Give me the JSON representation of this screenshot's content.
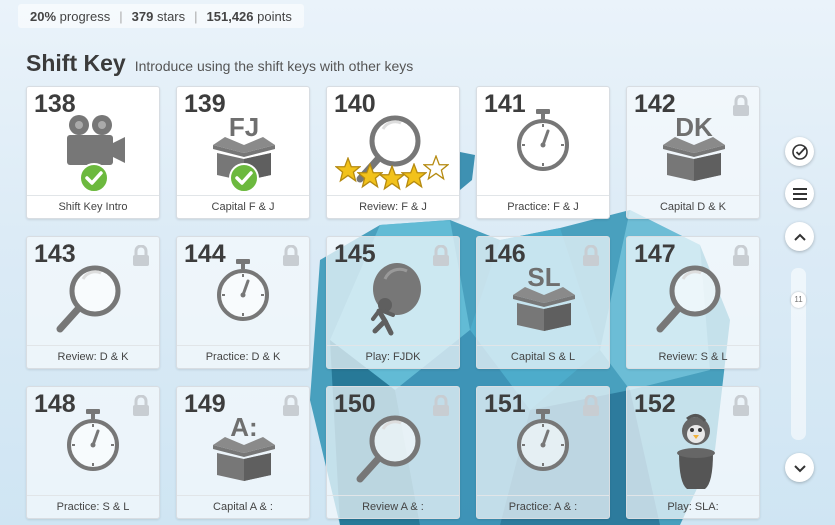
{
  "stats": {
    "progress_value": "20%",
    "progress_label": "progress",
    "stars_value": "379",
    "stars_label": "stars",
    "points_value": "151,426",
    "points_label": "points"
  },
  "section": {
    "title": "Shift Key",
    "subtitle": "Introduce using the shift keys with other keys"
  },
  "lessons": [
    {
      "num": "138",
      "label": "Shift Key Intro",
      "icon": "video-camera-icon",
      "locked": false,
      "status": "completed"
    },
    {
      "num": "139",
      "label": "Capital F & J",
      "icon": "box-icon",
      "keys": "FJ",
      "locked": false,
      "status": "completed"
    },
    {
      "num": "140",
      "label": "Review: F & J",
      "icon": "magnifier-icon",
      "locked": false,
      "stars": 4,
      "max_stars": 5
    },
    {
      "num": "141",
      "label": "Practice: F & J",
      "icon": "stopwatch-icon",
      "locked": false
    },
    {
      "num": "142",
      "label": "Capital D & K",
      "icon": "box-icon",
      "keys": "DK",
      "locked": true
    },
    {
      "num": "143",
      "label": "Review: D & K",
      "icon": "magnifier-icon",
      "locked": true
    },
    {
      "num": "144",
      "label": "Practice: D & K",
      "icon": "stopwatch-icon",
      "locked": true
    },
    {
      "num": "145",
      "label": "Play: FJDK",
      "icon": "game-character-icon",
      "locked": true
    },
    {
      "num": "146",
      "label": "Capital S & L",
      "icon": "box-icon",
      "keys": "SL",
      "locked": true
    },
    {
      "num": "147",
      "label": "Review: S & L",
      "icon": "magnifier-icon",
      "locked": true
    },
    {
      "num": "148",
      "label": "Practice: S & L",
      "icon": "stopwatch-icon",
      "locked": true
    },
    {
      "num": "149",
      "label": "Capital A & :",
      "icon": "box-icon",
      "keys": "A:",
      "locked": true
    },
    {
      "num": "150",
      "label": "Review A & :",
      "icon": "magnifier-icon",
      "locked": true
    },
    {
      "num": "151",
      "label": "Practice: A & :",
      "icon": "stopwatch-icon",
      "locked": true
    },
    {
      "num": "152",
      "label": "Play: SLA:",
      "icon": "penguin-icon",
      "locked": true
    }
  ],
  "sidebar": {
    "scroll_position": "11",
    "buttons": [
      "check-circle-icon",
      "menu-icon",
      "chevron-up-icon",
      "chevron-down-icon"
    ]
  },
  "colors": {
    "gold_star": "#f2c21b",
    "check_green": "#6cb93e",
    "icon_gray": "#777777",
    "lock_gray": "#c8cdd2"
  }
}
